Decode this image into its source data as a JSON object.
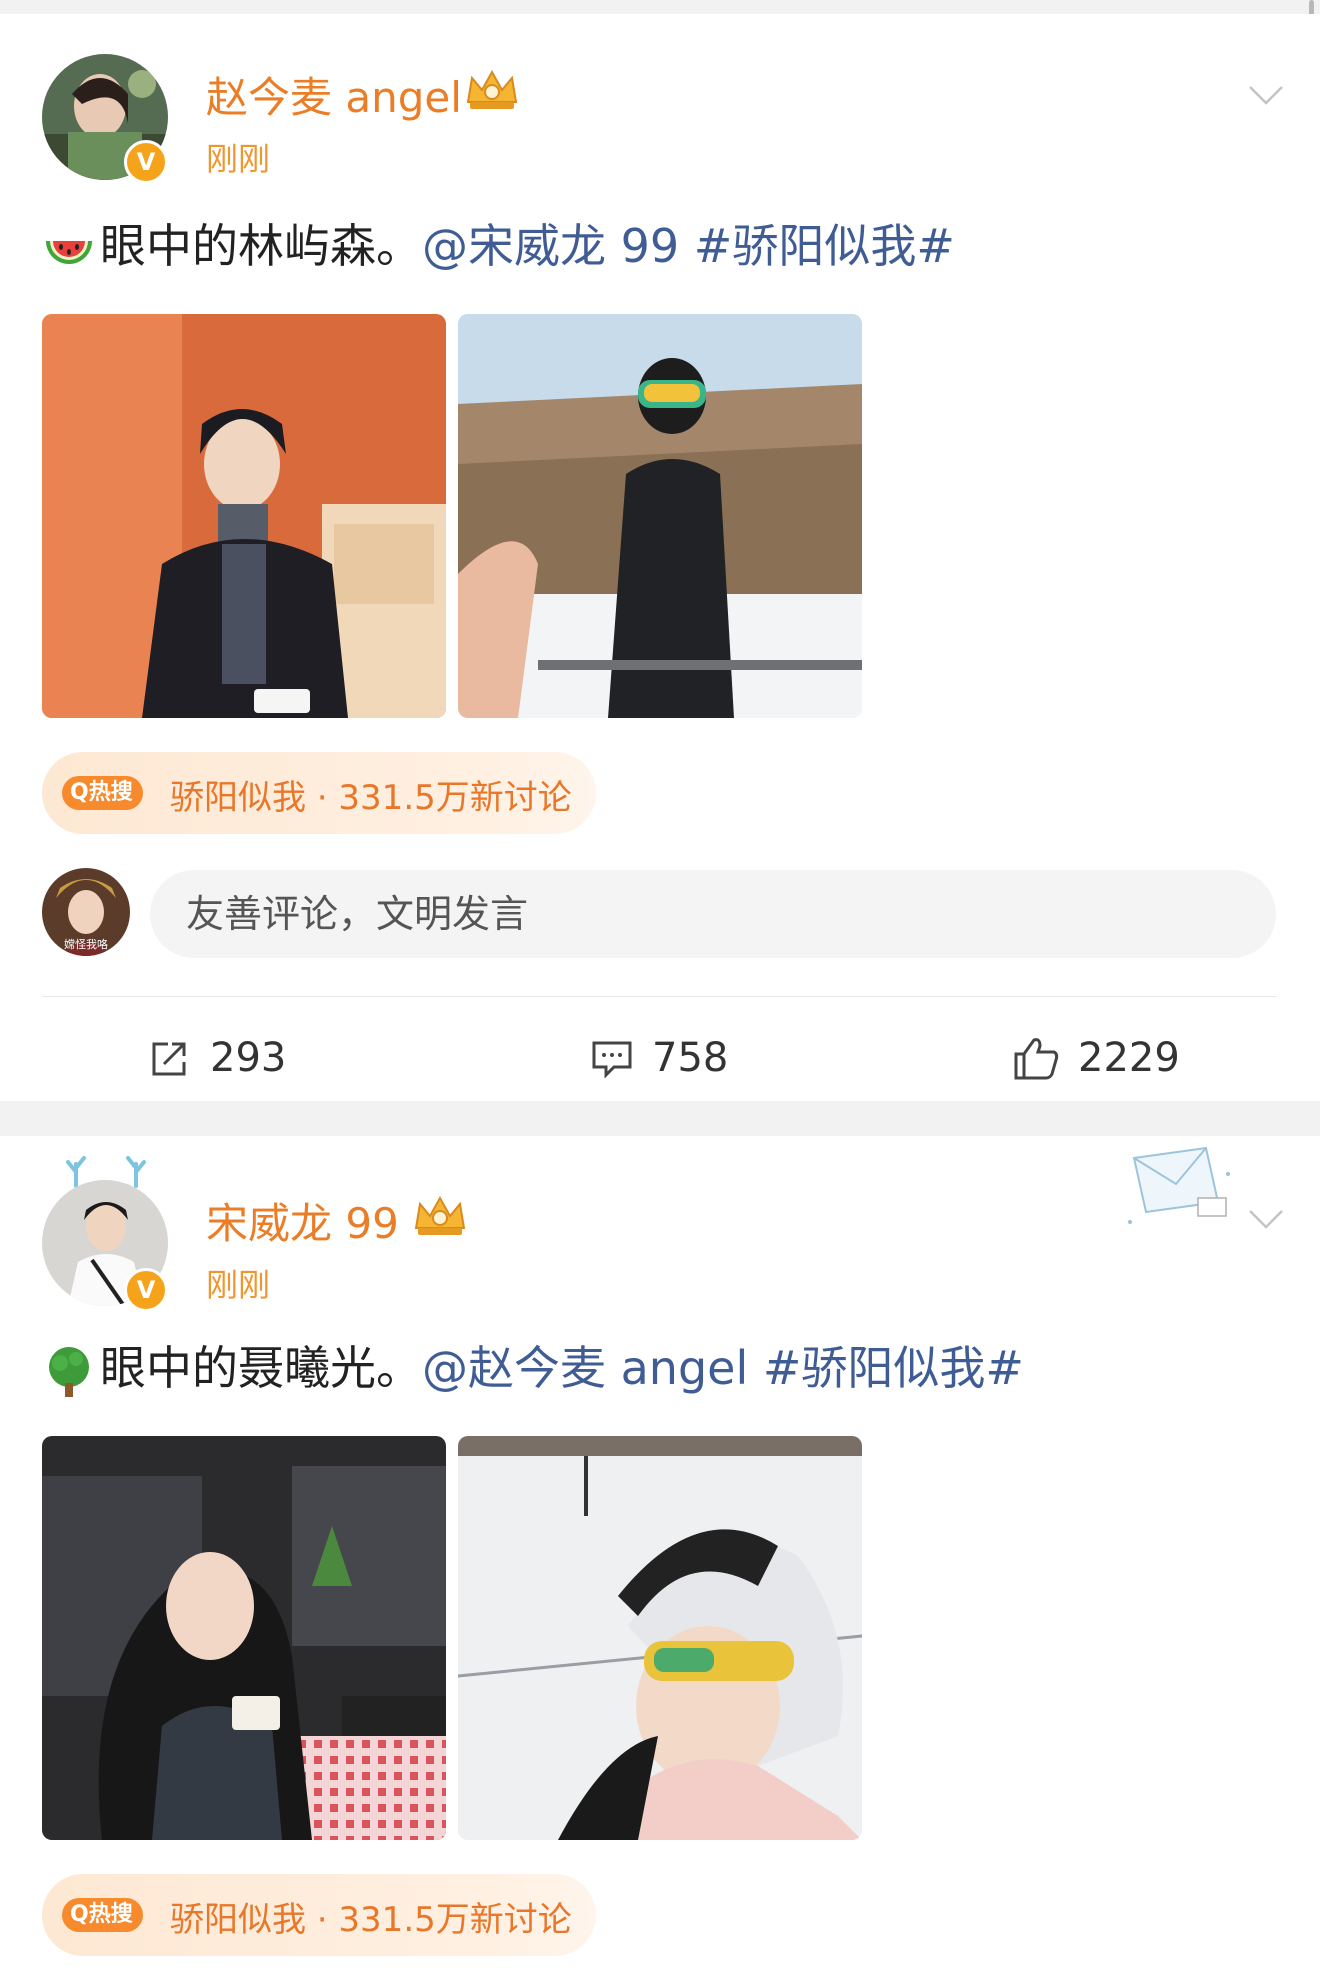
{
  "posts": [
    {
      "username": "赵今麦 angel",
      "timestamp": "刚刚",
      "content": {
        "emoji": "watermelon",
        "text": "眼中的林屿森。",
        "mention": "@宋威龙 99",
        "hashtag": "#骄阳似我#"
      },
      "hot_search": {
        "tag": "Q热搜",
        "text": "骄阳似我 · 331.5万新讨论"
      }
    },
    {
      "username": "宋威龙 99",
      "timestamp": "刚刚",
      "content": {
        "emoji": "tree",
        "text": "眼中的聂曦光。",
        "mention": "@赵今麦 angel",
        "hashtag": "#骄阳似我#"
      },
      "hot_search": {
        "tag": "Q热搜",
        "text": "骄阳似我 · 331.5万新讨论"
      }
    }
  ],
  "comment": {
    "placeholder": "友善评论，文明发言",
    "avatar_caption": "嫦怪我咯"
  },
  "actions": {
    "repost": "293",
    "comments": "758",
    "likes": "2229"
  },
  "icons": [
    "chevron-down-icon",
    "crown-icon",
    "verified-icon",
    "repost-icon",
    "comment-icon",
    "like-icon",
    "watermelon-icon",
    "tree-icon"
  ],
  "colors": {
    "username": "#eb7d26",
    "link": "#3f5d94",
    "hot_tag": "#f68a2c",
    "verified": "#f5a31a"
  }
}
